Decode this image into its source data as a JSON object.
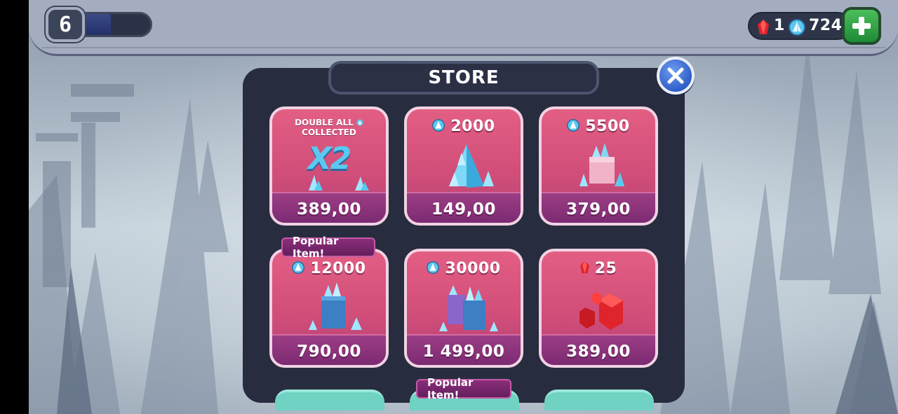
{
  "hud": {
    "level": "6",
    "level_progress": 0.5,
    "currencies": {
      "ruby": {
        "icon": "ruby-gem-icon",
        "value": "1"
      },
      "crystal": {
        "icon": "crystal-icon",
        "value": "724"
      }
    },
    "add_icon": "plus-icon"
  },
  "store": {
    "title": "STORE",
    "close_icon": "close-icon",
    "items": [
      {
        "caption_line1": "DOUBLE ALL",
        "caption_line2": "COLLECTED",
        "art_label": "X2",
        "price": "389,00"
      },
      {
        "amount": "2000",
        "currency": "crystal",
        "price": "149,00"
      },
      {
        "amount": "5500",
        "currency": "crystal",
        "price": "379,00"
      },
      {
        "amount": "12000",
        "currency": "crystal",
        "price": "790,00",
        "tag": "Popular Item!"
      },
      {
        "amount": "30000",
        "currency": "crystal",
        "price": "1 499,00"
      },
      {
        "amount": "25",
        "currency": "ruby",
        "price": "389,00"
      }
    ],
    "bottom_tag": "Popular Item!"
  },
  "colors": {
    "panel": "#282c3f",
    "card_pink": "#d9517c",
    "price_band": "#8a3379",
    "crystal_blue": "#5bc9ef",
    "ruby_red": "#e0242c",
    "add_green": "#2fa145",
    "close_blue": "#3d6fd6"
  }
}
